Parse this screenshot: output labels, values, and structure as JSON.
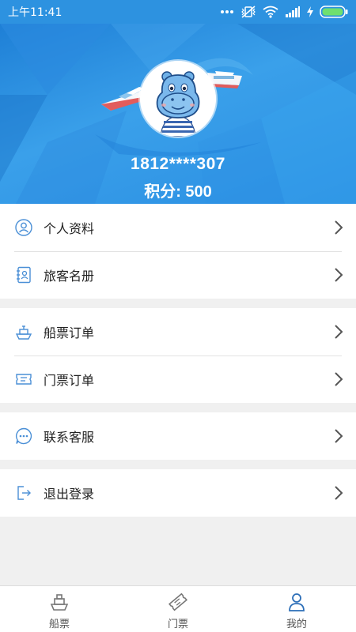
{
  "status_bar": {
    "time": "上午11:41"
  },
  "profile": {
    "phone": "1812****307",
    "points": "积分: 500"
  },
  "menu_groups": [
    {
      "items": [
        {
          "label": "个人资料",
          "icon": "person-icon"
        },
        {
          "label": "旅客名册",
          "icon": "contacts-book-icon"
        }
      ]
    },
    {
      "items": [
        {
          "label": "船票订单",
          "icon": "ship-icon"
        },
        {
          "label": "门票订单",
          "icon": "ticket-icon"
        }
      ]
    },
    {
      "items": [
        {
          "label": "联系客服",
          "icon": "chat-icon"
        }
      ]
    },
    {
      "items": [
        {
          "label": "退出登录",
          "icon": "logout-icon"
        }
      ]
    }
  ],
  "bottom_nav": {
    "tabs": [
      {
        "label": "船票",
        "icon": "ship-icon"
      },
      {
        "label": "门票",
        "icon": "ticket-icon"
      },
      {
        "label": "我的",
        "icon": "user-icon",
        "active": true
      }
    ]
  },
  "colors": {
    "brand_blue": "#2d92e0",
    "icon_blue": "#4a8fd6"
  }
}
